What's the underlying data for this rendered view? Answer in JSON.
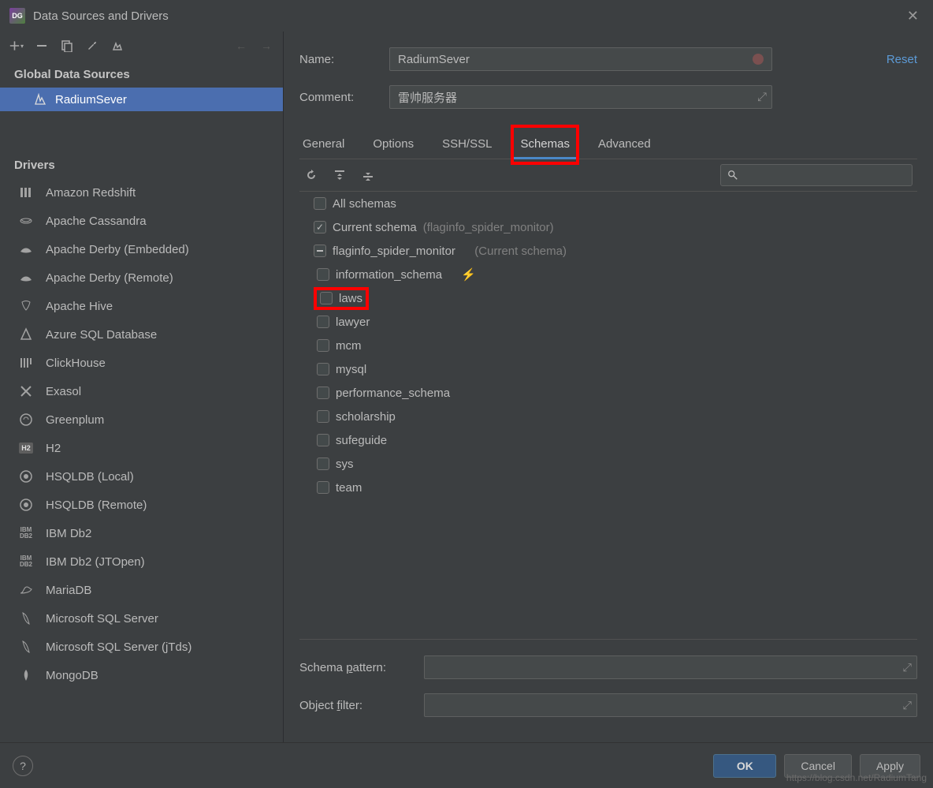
{
  "window": {
    "title": "Data Sources and Drivers"
  },
  "sidebar": {
    "global_header": "Global Data Sources",
    "data_source": "RadiumSever",
    "drivers_header": "Drivers",
    "drivers": [
      "Amazon Redshift",
      "Apache Cassandra",
      "Apache Derby (Embedded)",
      "Apache Derby (Remote)",
      "Apache Hive",
      "Azure SQL Database",
      "ClickHouse",
      "Exasol",
      "Greenplum",
      "H2",
      "HSQLDB (Local)",
      "HSQLDB (Remote)",
      "IBM Db2",
      "IBM Db2 (JTOpen)",
      "MariaDB",
      "Microsoft SQL Server",
      "Microsoft SQL Server (jTds)",
      "MongoDB"
    ]
  },
  "form": {
    "name_label": "Name:",
    "name_value": "RadiumSever",
    "comment_label": "Comment:",
    "comment_value": "雷帅服务器",
    "reset": "Reset"
  },
  "tabs": [
    "General",
    "Options",
    "SSH/SSL",
    "Schemas",
    "Advanced"
  ],
  "schemas": {
    "all_schemas": "All schemas",
    "current_schema": "Current schema",
    "current_schema_hint": "(flaginfo_spider_monitor)",
    "db_name": "flaginfo_spider_monitor",
    "db_hint": "(Current schema)",
    "items": [
      "information_schema",
      "laws",
      "lawyer",
      "mcm",
      "mysql",
      "performance_schema",
      "scholarship",
      "sufeguide",
      "sys",
      "team"
    ]
  },
  "bottom": {
    "pattern_label_pre": "Schema ",
    "pattern_label_u": "p",
    "pattern_label_post": "attern:",
    "filter_label_pre": "Object ",
    "filter_label_u": "f",
    "filter_label_post": "ilter:"
  },
  "buttons": {
    "ok": "OK",
    "cancel": "Cancel",
    "apply": "Apply"
  },
  "watermark": "https://blog.csdn.net/RadiumTang"
}
